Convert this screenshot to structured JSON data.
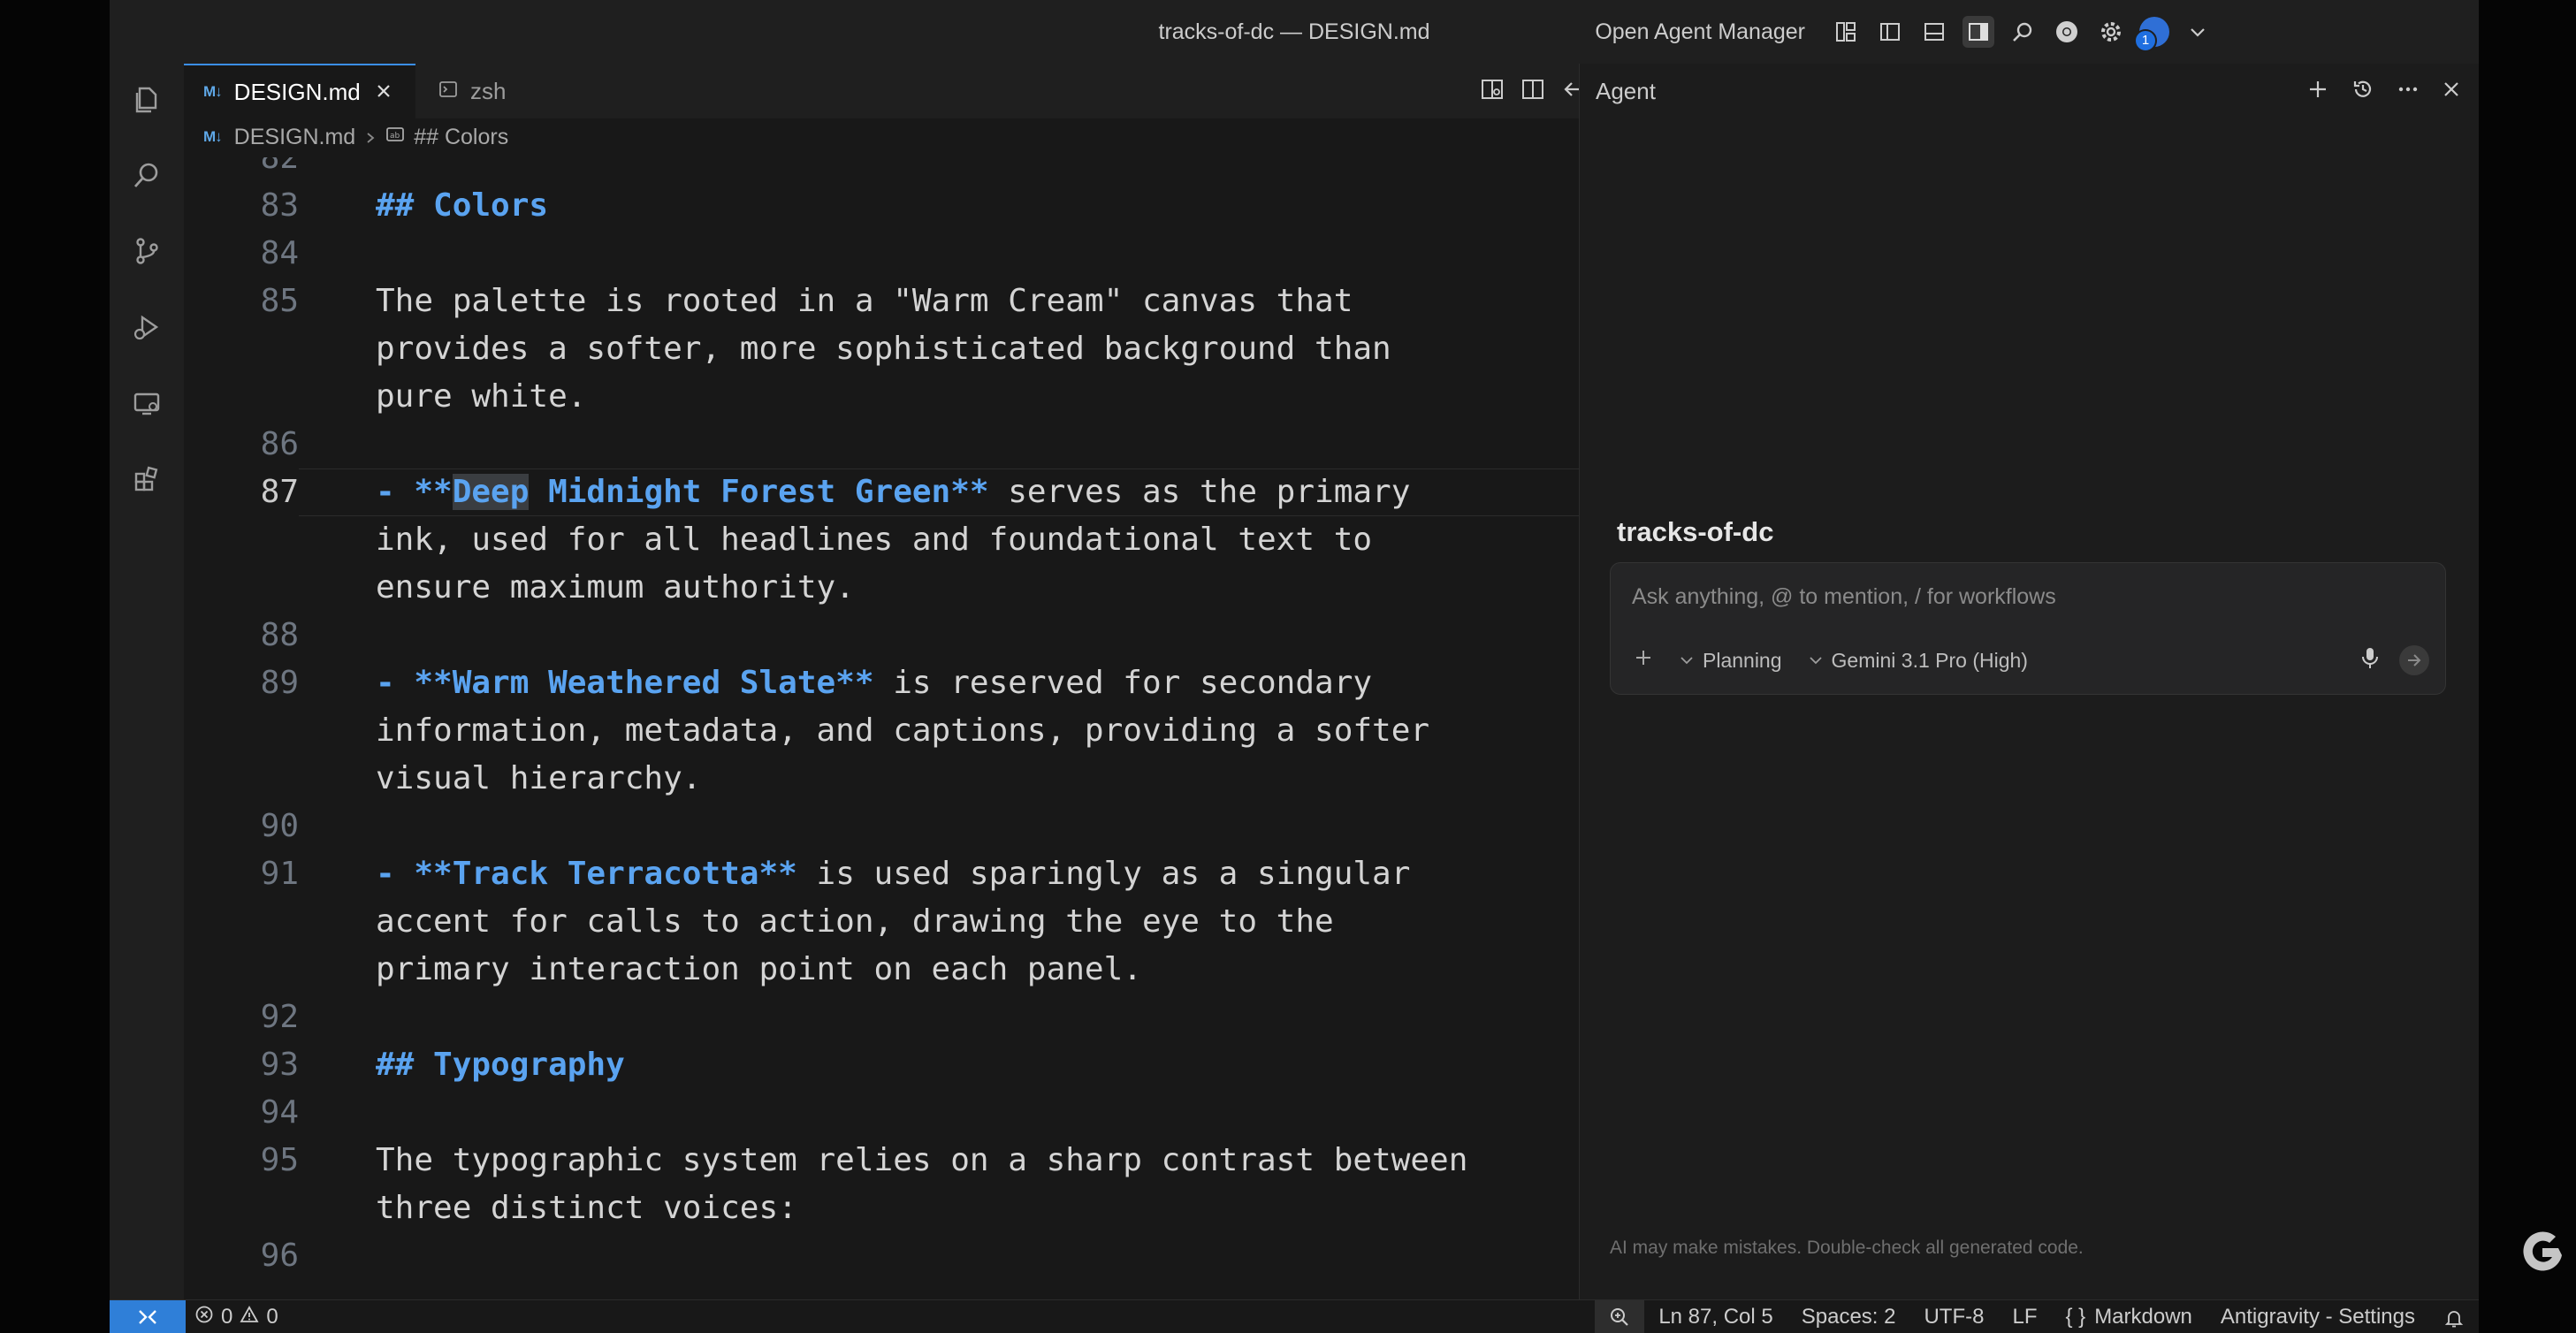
{
  "window": {
    "title": "tracks-of-dc — DESIGN.md",
    "open_agent_manager": "Open Agent Manager"
  },
  "tabs": [
    {
      "label": "DESIGN.md",
      "icon": "M↓"
    },
    {
      "label": "zsh"
    }
  ],
  "breadcrumb": {
    "file": "DESIGN.md",
    "section": "## Colors"
  },
  "editor": {
    "partial_top_line": "82",
    "lines": [
      {
        "n": "83",
        "text": "## Colors"
      },
      {
        "n": "84"
      },
      {
        "n": "85",
        "wrap": [
          "The palette is rooted in a \"Warm Cream\" canvas that",
          "provides a softer, more sophisticated background than",
          "pure white."
        ]
      },
      {
        "n": "86"
      },
      {
        "n": "87",
        "bullet": "- **",
        "sel": "Deep",
        "bold": " Midnight Forest Green**",
        "rest": " serves as the primary",
        "wrap": [
          "ink, used for all headlines and foundational text to",
          "ensure maximum authority."
        ]
      },
      {
        "n": "88"
      },
      {
        "n": "89",
        "bullet": "- **",
        "bold": "Warm Weathered Slate**",
        "rest": " is reserved for secondary",
        "wrap": [
          "information, metadata, and captions, providing a softer",
          "visual hierarchy."
        ]
      },
      {
        "n": "90"
      },
      {
        "n": "91",
        "bullet": "- **",
        "bold": "Track Terracotta**",
        "rest": " is used sparingly as a singular",
        "wrap": [
          "accent for calls to action, drawing the eye to the",
          "primary interaction point on each panel."
        ]
      },
      {
        "n": "92"
      },
      {
        "n": "93",
        "text": "## Typography"
      },
      {
        "n": "94"
      },
      {
        "n": "95",
        "wrap": [
          "The typographic system relies on a sharp contrast between",
          "three distinct voices:"
        ]
      },
      {
        "n": "96"
      }
    ]
  },
  "agent": {
    "title": "Agent",
    "workspace": "tracks-of-dc",
    "placeholder": "Ask anything, @ to mention, / for workflows",
    "mode": "Planning",
    "model": "Gemini 3.1 Pro (High)",
    "disclaimer": "AI may make mistakes. Double-check all generated code."
  },
  "status": {
    "errors": "0",
    "warnings": "0",
    "position": "Ln 87, Col 5",
    "spaces": "Spaces: 2",
    "encoding": "UTF-8",
    "eol": "LF",
    "language": "Markdown",
    "settings": "Antigravity - Settings"
  },
  "user": {
    "notification_count": "1"
  },
  "colors": {
    "accent": "#2f7fd8",
    "markdown_heading": "#5aa3f0",
    "editor_bg": "#181818"
  }
}
